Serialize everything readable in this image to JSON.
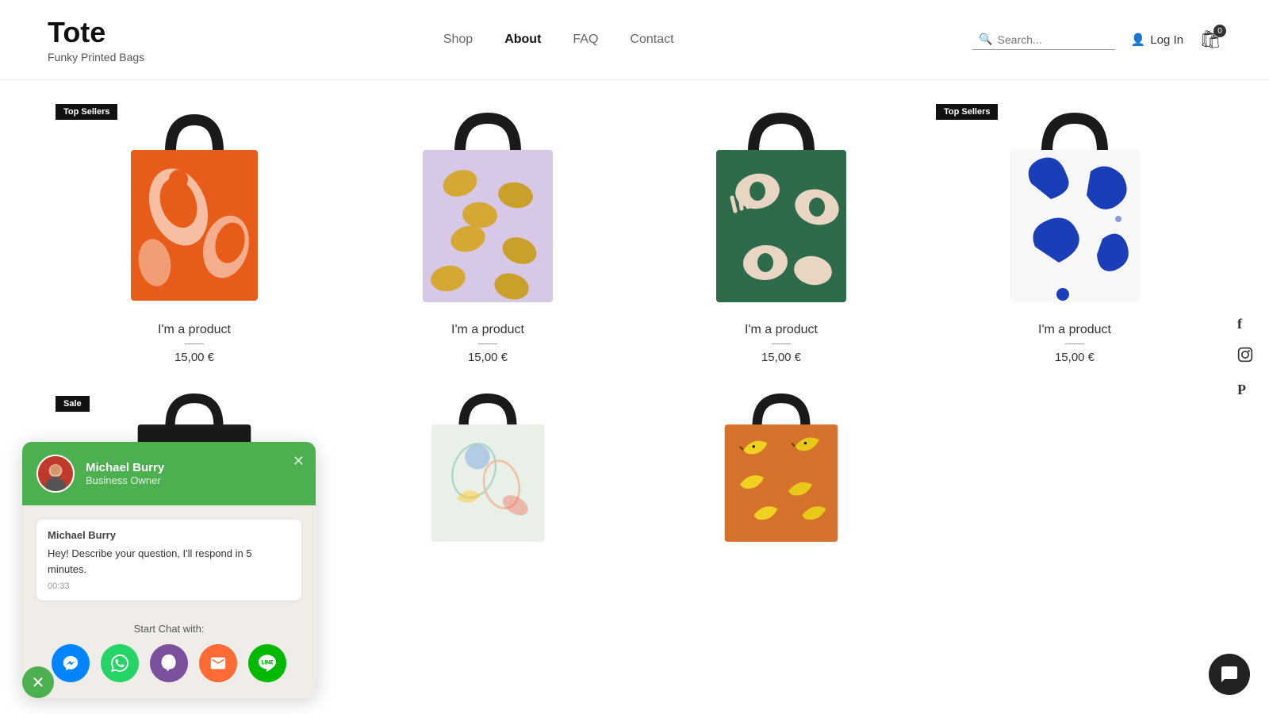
{
  "header": {
    "logo": "Tote",
    "tagline": "Funky Printed Bags",
    "nav": [
      {
        "label": "Shop",
        "active": false
      },
      {
        "label": "About",
        "active": true
      },
      {
        "label": "FAQ",
        "active": false
      },
      {
        "label": "Contact",
        "active": false
      }
    ],
    "search_placeholder": "Search...",
    "login_label": "Log In",
    "cart_count": "0"
  },
  "products_row1": [
    {
      "name": "I'm a product",
      "price": "15,00 €",
      "badge": "Top Sellers",
      "color": "orange"
    },
    {
      "name": "I'm a product",
      "price": "15,00 €",
      "badge": null,
      "color": "lavender"
    },
    {
      "name": "I'm a product",
      "price": "15,00 €",
      "badge": null,
      "color": "green"
    },
    {
      "name": "I'm a product",
      "price": "15,00 €",
      "badge": "Top Sellers",
      "color": "blue"
    }
  ],
  "products_row2": [
    {
      "name": "",
      "price": "",
      "badge": "Sale",
      "color": "black"
    },
    {
      "name": "",
      "price": "",
      "badge": null,
      "color": "light"
    },
    {
      "name": "",
      "price": "",
      "badge": null,
      "color": "banana"
    }
  ],
  "social": {
    "facebook": "f",
    "instagram": "📷",
    "pinterest": "P"
  },
  "chat": {
    "header_bg": "#4CAF50",
    "user_name": "Michael Burry",
    "user_role": "Business Owner",
    "message_sender": "Michael Burry",
    "message_text": "Hey! Describe your question, I'll respond in 5 minutes.",
    "message_time": "00:33",
    "start_label": "Start Chat with:",
    "apps": [
      {
        "name": "Messenger",
        "icon": "m"
      },
      {
        "name": "WhatsApp",
        "icon": "w"
      },
      {
        "name": "Viber",
        "icon": "v"
      },
      {
        "name": "Email",
        "icon": "e"
      },
      {
        "name": "Line",
        "icon": "L"
      }
    ]
  }
}
